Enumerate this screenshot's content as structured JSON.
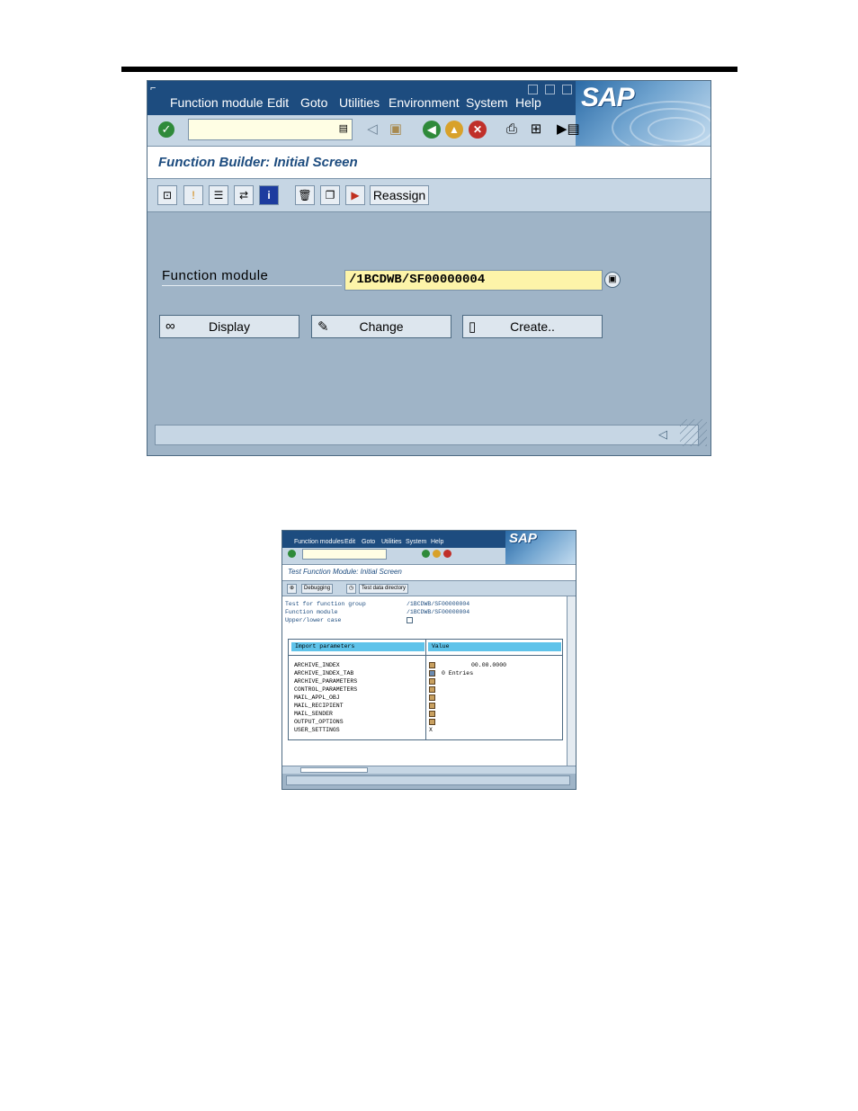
{
  "screen1": {
    "menu": [
      "Function module",
      "Edit",
      "Goto",
      "Utilities",
      "Environment",
      "System",
      "Help"
    ],
    "logo": "SAP",
    "title": "Function Builder: Initial Screen",
    "reassign_label": "Reassign",
    "field_label": "Function module",
    "field_value": "/1BCDWB/SF00000004",
    "buttons": {
      "display": "Display",
      "change": "Change",
      "create": "Create.."
    }
  },
  "screen2": {
    "menu": [
      "Function modules",
      "Edit",
      "Goto",
      "Utilities",
      "System",
      "Help"
    ],
    "logo": "SAP",
    "title": "Test Function Module: Initial Screen",
    "app_buttons": {
      "debugging": "Debugging",
      "test_data": "Test data directory"
    },
    "info": [
      {
        "label": "Test for function group",
        "value": "/1BCDWB/SF00000004"
      },
      {
        "label": "Function module",
        "value": "/1BCDWB/SF00000004"
      },
      {
        "label": "Upper/lower case",
        "value": ""
      }
    ],
    "table": {
      "header_params": "Import parameters",
      "header_value": "Value",
      "rows": [
        {
          "name": "ARCHIVE_INDEX",
          "value": "00.00.0000"
        },
        {
          "name": "ARCHIVE_INDEX_TAB",
          "value": "0 Entries"
        },
        {
          "name": "ARCHIVE_PARAMETERS",
          "value": ""
        },
        {
          "name": "CONTROL_PARAMETERS",
          "value": ""
        },
        {
          "name": "MAIL_APPL_OBJ",
          "value": ""
        },
        {
          "name": "MAIL_RECIPIENT",
          "value": ""
        },
        {
          "name": "MAIL_SENDER",
          "value": ""
        },
        {
          "name": "OUTPUT_OPTIONS",
          "value": ""
        },
        {
          "name": "USER_SETTINGS",
          "value": "X"
        }
      ]
    }
  }
}
